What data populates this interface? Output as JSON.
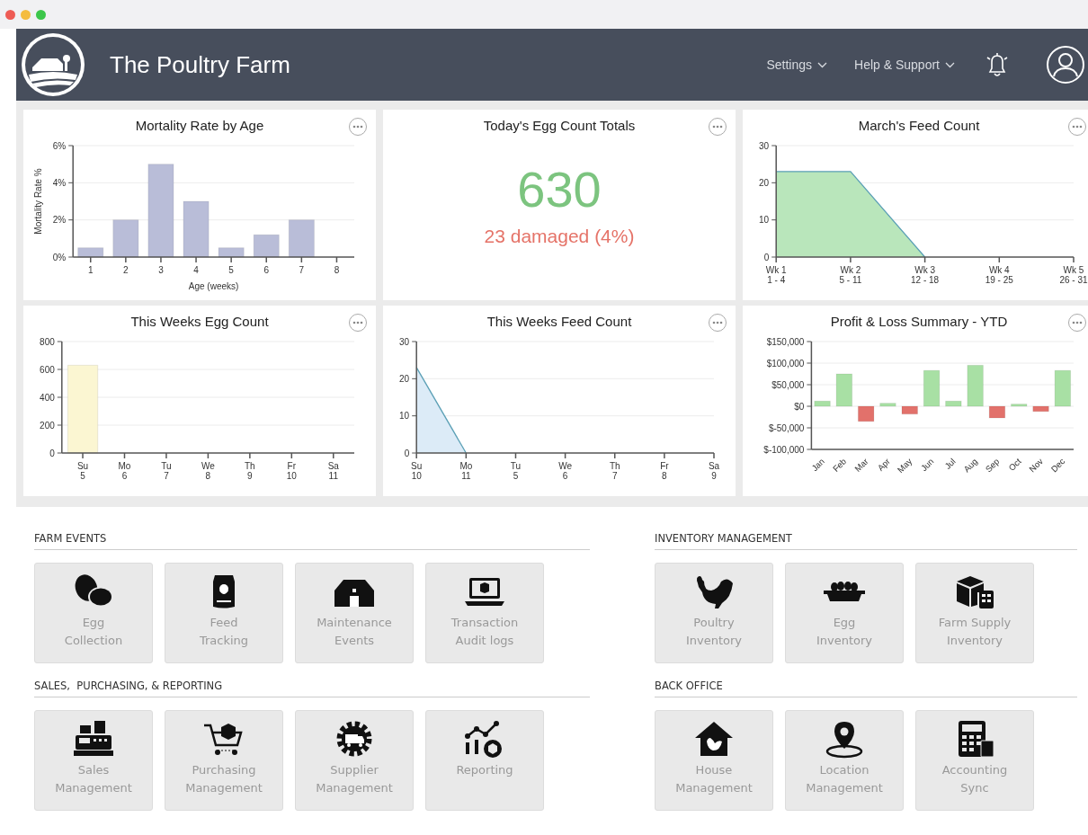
{
  "app": {
    "title": "The Poultry Farm",
    "nav": [
      {
        "label": "Settings"
      },
      {
        "label": "Help & Support"
      }
    ]
  },
  "cards": [
    {
      "kind": "chart",
      "chart_data": {
        "type": "bar",
        "title": "Mortality Rate by Age",
        "xlabel": "Age (weeks)",
        "ylabel": "Mortality Rate %",
        "grid": true,
        "categories": [
          "1",
          "2",
          "3",
          "4",
          "5",
          "6",
          "7",
          "8"
        ],
        "series": [
          {
            "color": "#b9bdd8",
            "values": [
              0.5,
              2,
              5,
              3,
              0.5,
              1.2,
              2,
              null
            ]
          }
        ],
        "ylim": [
          0,
          6
        ],
        "yticks": [
          {
            "value": 0,
            "label": "0%"
          },
          {
            "value": 2,
            "label": "2%"
          },
          {
            "value": 4,
            "label": "4%"
          },
          {
            "value": 6,
            "label": "6%"
          }
        ]
      }
    },
    {
      "kind": "stat",
      "title": "Today's Egg Count Totals",
      "value": "630",
      "note": "23 damaged (4%)"
    },
    {
      "kind": "chart",
      "chart_data": {
        "type": "area",
        "title": "March's Feed Count",
        "grid": true,
        "categories": [
          "Wk 1\n1 - 4",
          "Wk 2\n5 - 11",
          "Wk 3\n12 - 18",
          "Wk 4\n19 - 25",
          "Wk 5\n26 - 31"
        ],
        "series": [
          {
            "color": "#b9e6bb",
            "values": [
              23,
              23,
              0,
              null,
              null
            ]
          }
        ],
        "ylim": [
          0,
          30
        ],
        "yticks": [
          0,
          10,
          20,
          30
        ]
      }
    },
    {
      "kind": "chart",
      "chart_data": {
        "type": "bar",
        "title": "This Weeks Egg Count",
        "grid": true,
        "categories": [
          "Su\n5",
          "Mo\n6",
          "Tu\n7",
          "We\n8",
          "Th\n9",
          "Fr\n10",
          "Sa\n11"
        ],
        "series": [
          {
            "color": "#fbf6d2",
            "values": [
              630,
              null,
              null,
              null,
              null,
              null,
              null
            ]
          }
        ],
        "ylim": [
          0,
          800
        ],
        "yticks": [
          0,
          200,
          400,
          600,
          800
        ]
      }
    },
    {
      "kind": "chart",
      "chart_data": {
        "type": "area",
        "title": "This Weeks Feed Count",
        "grid": true,
        "categories": [
          "Su\n10",
          "Mo\n11",
          "Tu\n5",
          "We\n6",
          "Th\n7",
          "Fr\n8",
          "Sa\n9"
        ],
        "series": [
          {
            "color": "#dcebf7",
            "values": [
              23,
              0,
              null,
              null,
              null,
              null,
              null
            ]
          }
        ],
        "ylim": [
          0,
          30
        ],
        "yticks": [
          0,
          10,
          20,
          30
        ]
      }
    },
    {
      "kind": "chart",
      "chart_data": {
        "type": "bar",
        "title": "Profit & Loss Summary - YTD",
        "grid": true,
        "categories": [
          "Jan",
          "Feb",
          "Mar",
          "Apr",
          "May",
          "Jun",
          "Jul",
          "Aug",
          "Sep",
          "Oct",
          "Nov",
          "Dec"
        ],
        "series": [
          {
            "color": "#a8e0a4",
            "values": [
              12000,
              75000,
              null,
              7000,
              null,
              83000,
              12000,
              95000,
              null,
              5000,
              null,
              83000
            ]
          },
          {
            "color": "#e2716b",
            "values": [
              null,
              null,
              -35000,
              null,
              -18000,
              null,
              null,
              null,
              -27000,
              null,
              -12000,
              null
            ]
          }
        ],
        "ylim": [
          -100000,
          150000
        ],
        "yticks": [
          {
            "value": -100000,
            "label": "$-100,000"
          },
          {
            "value": -50000,
            "label": "$-50,000"
          },
          {
            "value": 0,
            "label": "$0"
          },
          {
            "value": 50000,
            "label": "$50,000"
          },
          {
            "value": 100000,
            "label": "$100,000"
          },
          {
            "value": 150000,
            "label": "$150,000"
          }
        ]
      }
    }
  ],
  "sections": [
    {
      "title": "FARM EVENTS",
      "tiles": [
        "Egg\nCollection",
        "Feed\nTracking",
        "Maintenance\nEvents",
        "Transaction\nAudit logs"
      ]
    },
    {
      "title": "INVENTORY MANAGEMENT",
      "tiles": [
        "Poultry\nInventory",
        "Egg\nInventory",
        "Farm Supply\nInventory"
      ]
    },
    {
      "title": "SALES,  PURCHASING, & REPORTING",
      "tiles": [
        "Sales\nManagement",
        "Purchasing\nManagement",
        "Supplier\nManagement",
        "Reporting"
      ]
    },
    {
      "title": "BACK OFFICE",
      "tiles": [
        "House\nManagement",
        "Location\nManagement",
        "Accounting\nSync"
      ]
    }
  ]
}
